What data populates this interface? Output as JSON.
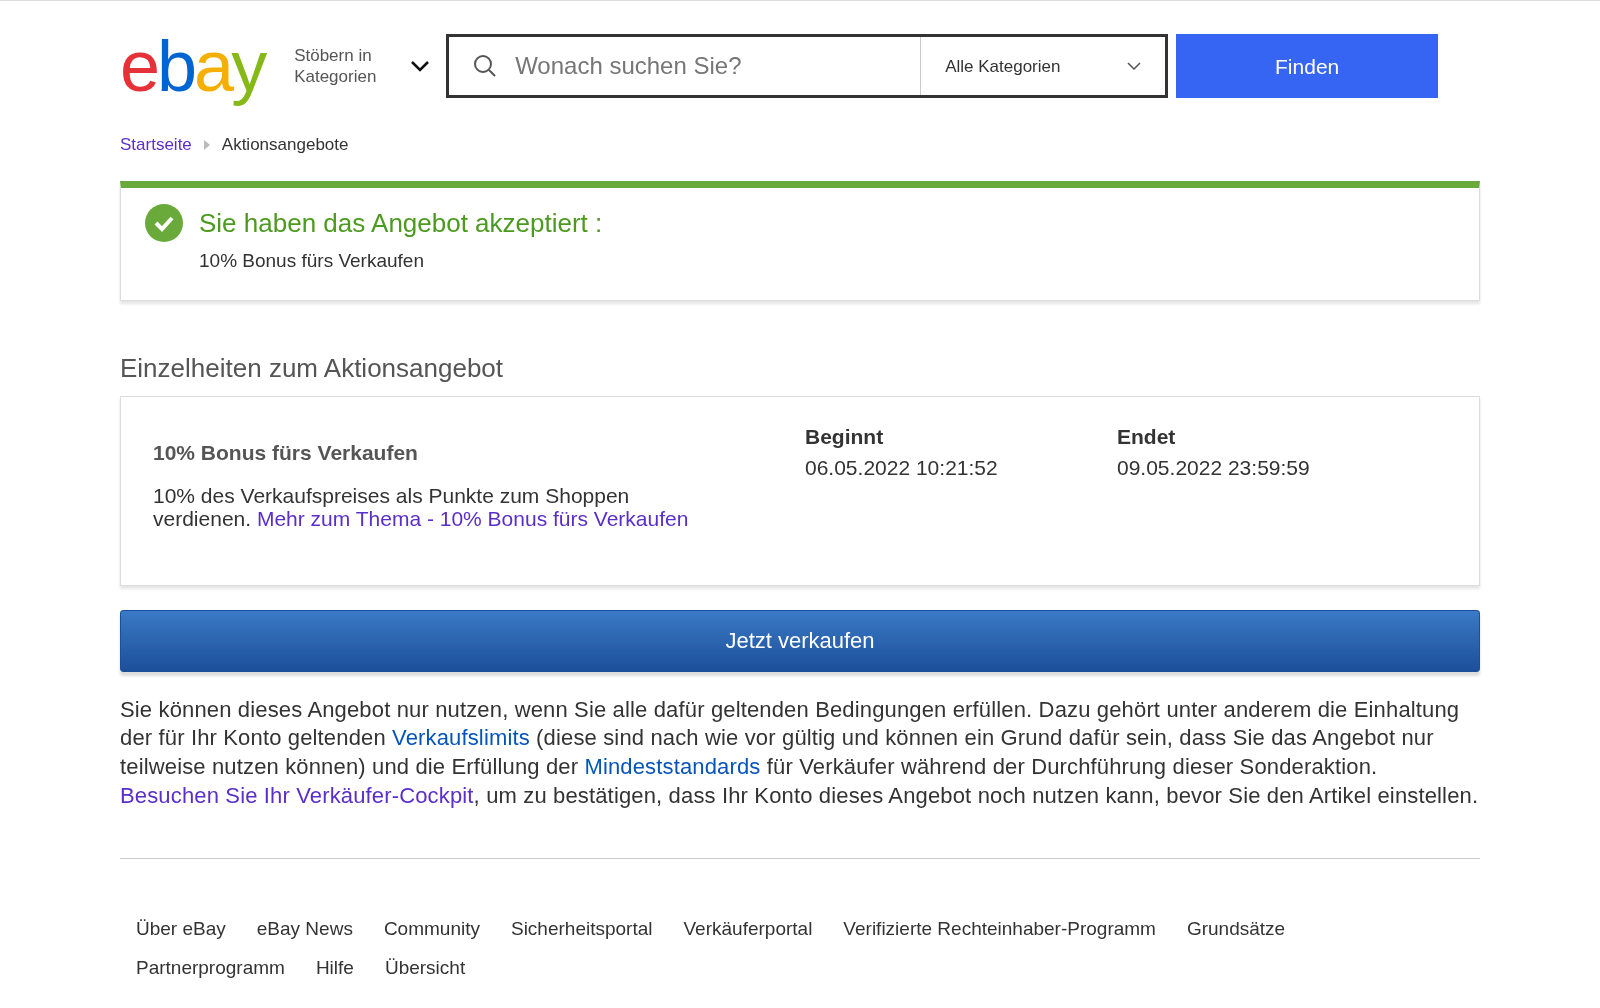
{
  "header": {
    "logo": "ebay",
    "browse": "Stöbern in Kategorien",
    "search": {
      "placeholder": "Wonach suchen Sie?"
    },
    "category": "Alle Kategorien",
    "find_button": "Finden"
  },
  "breadcrumb": [
    {
      "label": "Startseite",
      "kind": "link"
    },
    {
      "label": "Aktionsangebote",
      "kind": "current"
    }
  ],
  "alert": {
    "title": "Sie haben das Angebot akzeptiert :",
    "text": "10% Bonus fürs Verkaufen"
  },
  "details": {
    "heading": "Einzelheiten zum Aktionsangebot",
    "offer_title": "10% Bonus fürs Verkaufen",
    "description": "10% des Verkaufspreises als Punkte zum Shoppen verdienen.",
    "more_link": "Mehr zum Thema - 10% Bonus fürs Verkaufen",
    "dates": [
      {
        "label": "Beginnt",
        "value": "06.05.2022 10:21:52"
      },
      {
        "label": "Endet",
        "value": "09.05.2022 23:59:59"
      }
    ]
  },
  "sell_button": "Jetzt verkaufen",
  "terms": [
    {
      "text": "Sie können dieses Angebot nur nutzen, wenn Sie alle dafür geltenden Bedingungen erfüllen. Dazu gehört unter anderem die Einhaltung der für Ihr Konto geltenden ",
      "kind": "text"
    },
    {
      "text": "Verkaufslimits",
      "kind": "link",
      "visited": false
    },
    {
      "text": " (diese sind nach wie vor gültig und können ein Grund dafür sein, dass Sie das Angebot nur teilweise nutzen können) und die Erfüllung der ",
      "kind": "text"
    },
    {
      "text": "Mindeststandards",
      "kind": "link",
      "visited": false
    },
    {
      "text": " für Verkäufer während der Durchführung dieser Sonderaktion. ",
      "kind": "text"
    },
    {
      "text": "Besuchen Sie Ihr Verkäufer-Cockpit",
      "kind": "link",
      "visited": true
    },
    {
      "text": ", um zu bestätigen, dass Ihr Konto dieses Angebot noch nutzen kann, bevor Sie den Artikel einstellen.",
      "kind": "text"
    }
  ],
  "footer_links": [
    "Über eBay",
    "eBay News",
    "Community",
    "Sicherheitsportal",
    "Verkäuferportal",
    "Verifizierte Rechteinhaber-Programm",
    "Grundsätze",
    "Partnerprogramm",
    "Hilfe",
    "Übersicht"
  ]
}
